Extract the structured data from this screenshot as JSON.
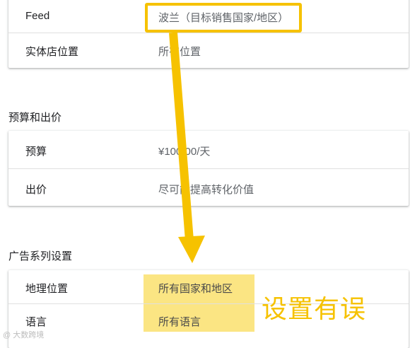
{
  "card1": {
    "rows": [
      {
        "label": "Feed",
        "value": "波兰（目标销售国家/地区）"
      },
      {
        "label": "实体店位置",
        "value": "所有位置"
      }
    ]
  },
  "budget_section": {
    "title": "预算和出价",
    "rows": [
      {
        "label": "预算",
        "value": "¥100.00/天"
      },
      {
        "label": "出价",
        "value": "尽可能提高转化价值"
      }
    ]
  },
  "campaign_section": {
    "title": "广告系列设置",
    "rows": [
      {
        "label": "地理位置",
        "value": "所有国家和地区"
      },
      {
        "label": "语言",
        "value": "所有语言"
      }
    ]
  },
  "annotation": {
    "text": "设置有误"
  },
  "watermark": {
    "text": "@ 大数跨境"
  },
  "colors": {
    "highlight": "#f6c200",
    "fill": "#fadc5a"
  }
}
